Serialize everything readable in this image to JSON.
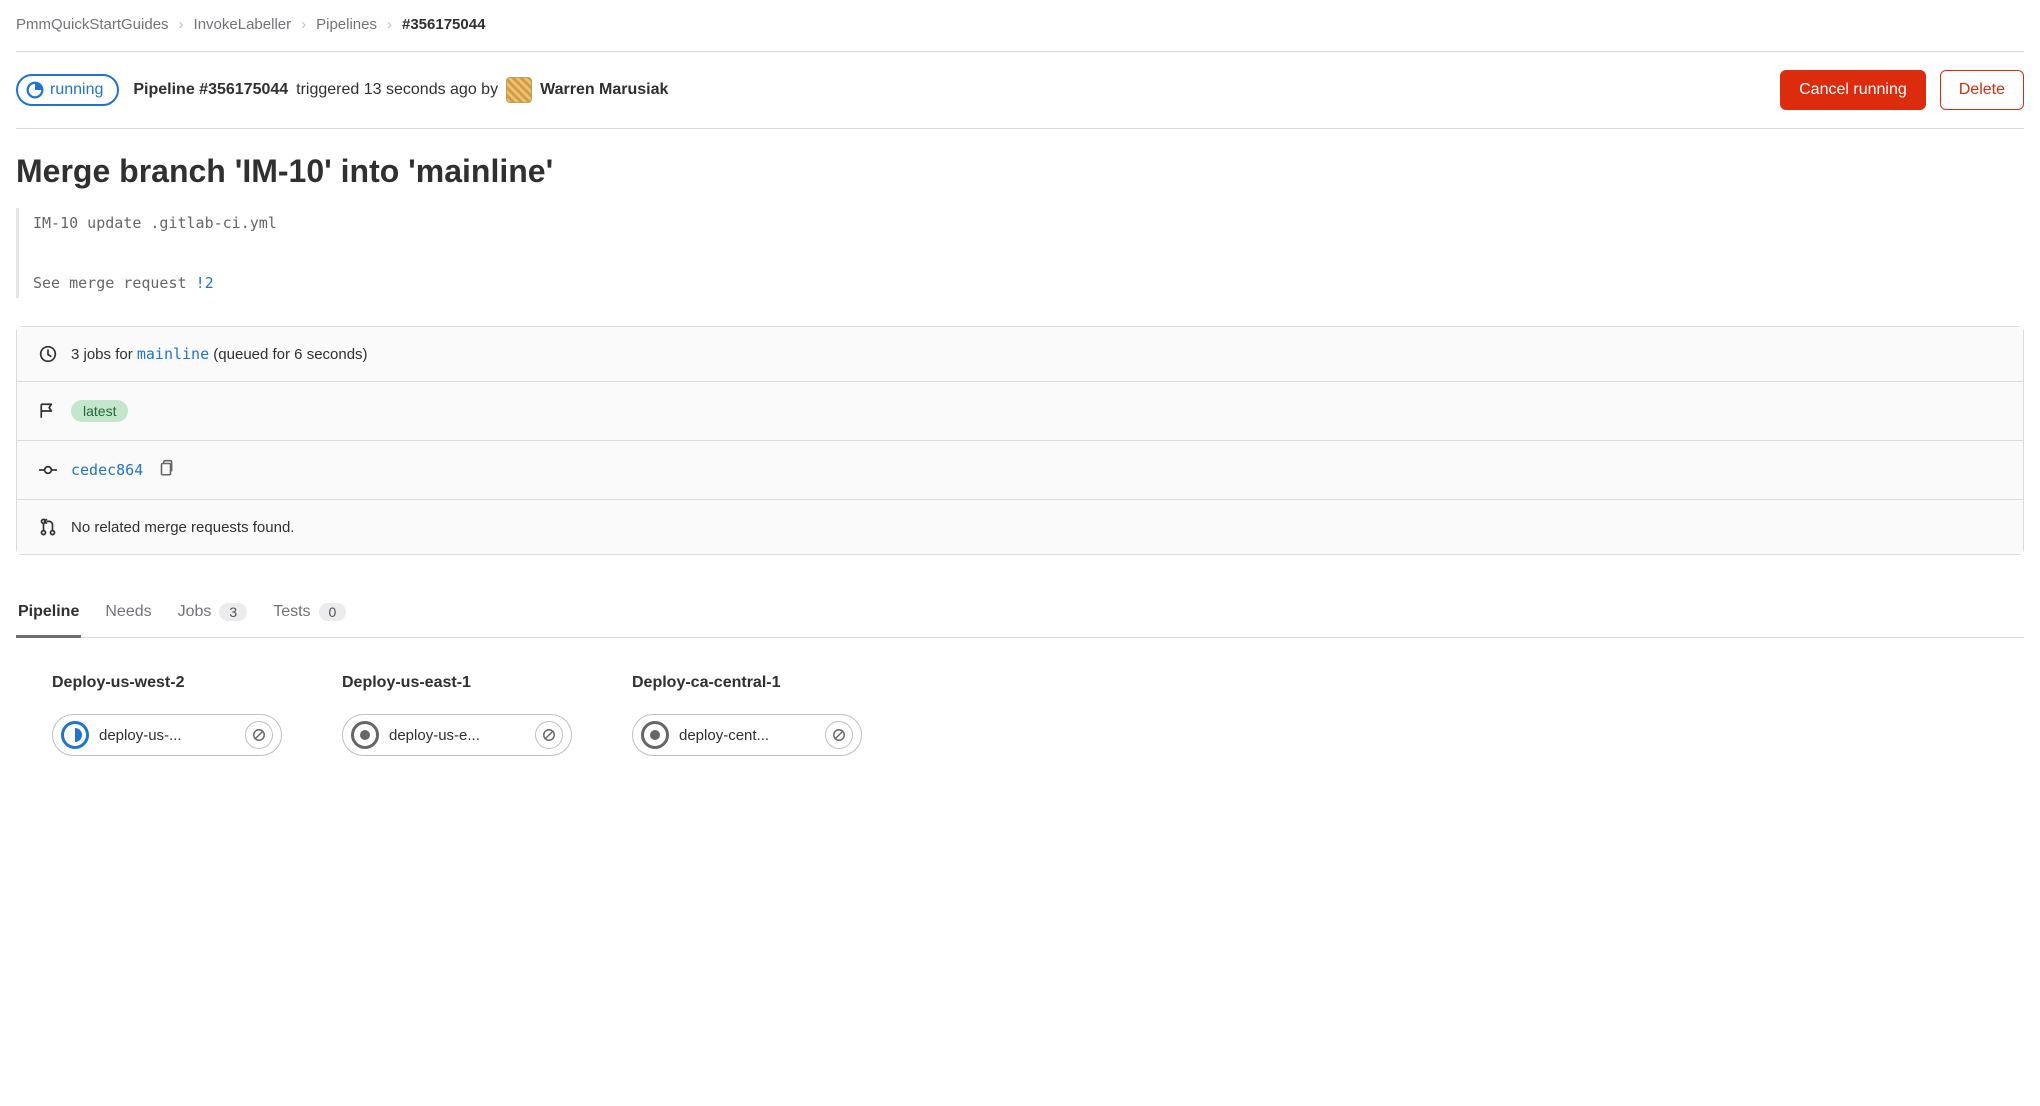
{
  "breadcrumb": {
    "items": [
      {
        "label": "PmmQuickStartGuides"
      },
      {
        "label": "InvokeLabeller"
      },
      {
        "label": "Pipelines"
      },
      {
        "label": "#356175044"
      }
    ]
  },
  "header": {
    "status": "running",
    "prefix": "Pipeline #356175044",
    "suffix": "triggered 13 seconds ago by",
    "author": "Warren Marusiak",
    "cancel_label": "Cancel running",
    "delete_label": "Delete"
  },
  "commit": {
    "title": "Merge branch 'IM-10' into 'mainline'",
    "desc_line1": "IM-10 update .gitlab-ci.yml",
    "desc_line2_pre": "See merge request ",
    "desc_line2_link": "!2"
  },
  "info": {
    "jobs_pre": "3 jobs for ",
    "branch": "mainline",
    "jobs_post": " (queued for 6 seconds)",
    "tag": "latest",
    "sha": "cedec864",
    "mr_text": "No related merge requests found."
  },
  "tabs": [
    {
      "label": "Pipeline",
      "count": null,
      "active": true
    },
    {
      "label": "Needs",
      "count": null,
      "active": false
    },
    {
      "label": "Jobs",
      "count": "3",
      "active": false
    },
    {
      "label": "Tests",
      "count": "0",
      "active": false
    }
  ],
  "stages": [
    {
      "name": "Deploy-us-west-2",
      "job": "deploy-us-...",
      "status": "running"
    },
    {
      "name": "Deploy-us-east-1",
      "job": "deploy-us-e...",
      "status": "created"
    },
    {
      "name": "Deploy-ca-central-1",
      "job": "deploy-cent...",
      "status": "created"
    }
  ]
}
